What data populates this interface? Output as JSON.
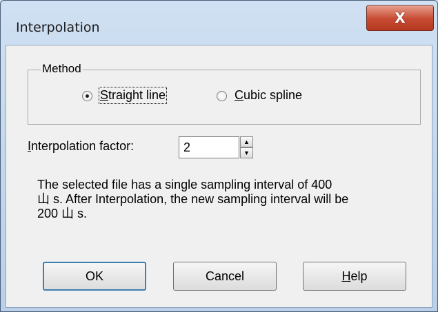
{
  "window": {
    "title": "Interpolation",
    "close_glyph": "X"
  },
  "method": {
    "legend": "Method",
    "options": [
      {
        "label": "Straight line",
        "mnemonic": "S",
        "rest": "traight line",
        "selected": true
      },
      {
        "label": "Cubic spline",
        "mnemonic": "C",
        "rest": "ubic spline",
        "selected": false
      }
    ]
  },
  "factor": {
    "label": "Interpolation factor:",
    "mnemonic": "I",
    "rest": "nterpolation factor:",
    "value": "2"
  },
  "info": {
    "line1": "The selected file has a single sampling interval of 400",
    "line2": "⼭ s. After Interpolation, the new sampling interval will be",
    "line3": "200 ⼭ s."
  },
  "buttons": {
    "ok": "OK",
    "cancel": "Cancel",
    "help_mnemonic": "H",
    "help_rest": "elp"
  },
  "icons": {
    "close": "close-icon",
    "spin_up": "spin-up-icon",
    "spin_down": "spin-down-icon"
  }
}
